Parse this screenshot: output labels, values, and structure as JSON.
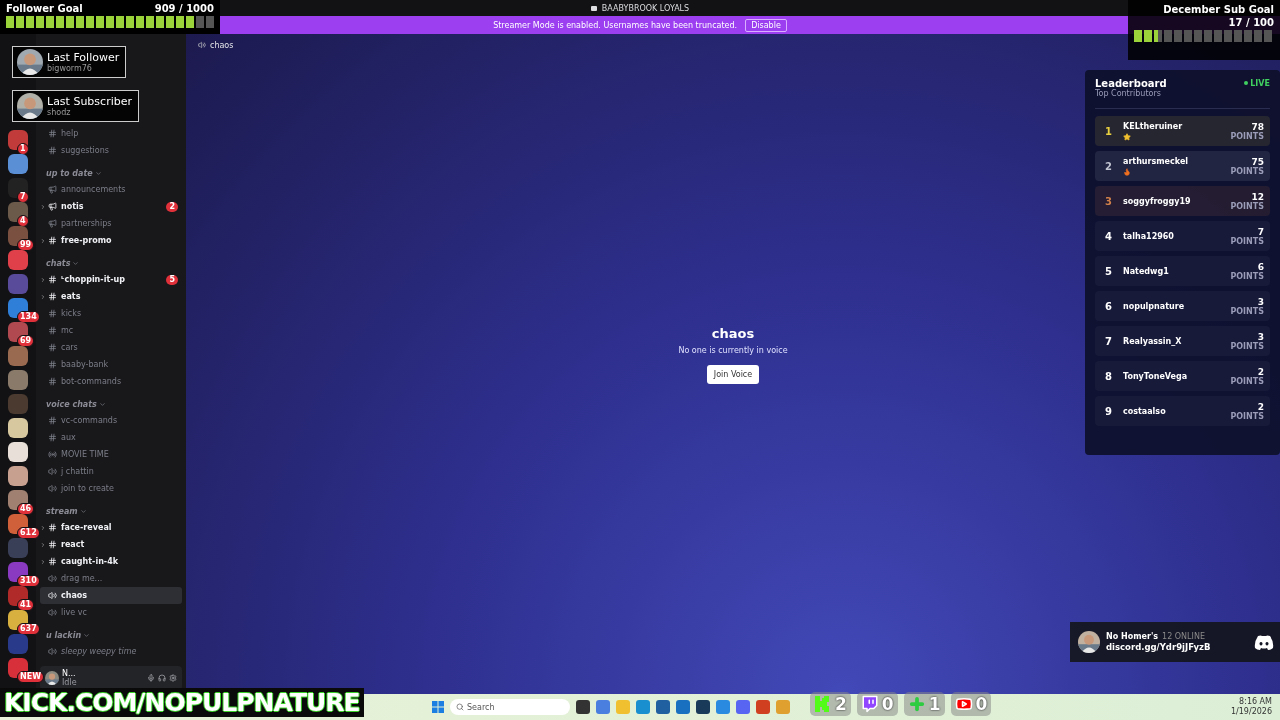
{
  "title_bar": {
    "title": "BAABYBROOK LOYALS"
  },
  "banner": {
    "text": "Streamer Mode is enabled. Usernames have been truncated.",
    "button": "Disable"
  },
  "servers": [
    {
      "color": "#c23b3b",
      "badge": "1"
    },
    {
      "color": "#5a8fd6"
    },
    {
      "color": "#222222",
      "badge": "7"
    },
    {
      "color": "#6b5a4a",
      "badge": "4"
    },
    {
      "color": "#7a5040",
      "badge": "99"
    },
    {
      "color": "#e0404a"
    },
    {
      "color": "#5a4a9a"
    },
    {
      "color": "#2f7fd8",
      "badge": "134"
    },
    {
      "color": "#b04a50",
      "badge": "69"
    },
    {
      "color": "#9a6a50"
    },
    {
      "color": "#8a7a6a"
    },
    {
      "color": "#4a3a30"
    },
    {
      "color": "#d8c8a0"
    },
    {
      "color": "#e8e0d8"
    },
    {
      "color": "#c8a090"
    },
    {
      "color": "#a08070",
      "badge": "46"
    },
    {
      "color": "#d0603a",
      "badge": "612"
    },
    {
      "color": "#3a3f58"
    },
    {
      "color": "#8a3ac0",
      "badge": "310"
    },
    {
      "color": "#b02a2a",
      "badge": "41"
    },
    {
      "color": "#d8b040",
      "badge": "637"
    },
    {
      "color": "#2a3a8a"
    },
    {
      "color": "#d8303a",
      "badge": "NEW"
    }
  ],
  "categories": [
    {
      "channels": [
        {
          "kind": "text",
          "name": "help",
          "unread": false,
          "selected": false,
          "threads": false
        },
        {
          "kind": "text",
          "name": "suggestions",
          "unread": false,
          "selected": false,
          "threads": false
        }
      ]
    },
    {
      "name": "up to date",
      "channels": [
        {
          "kind": "announcement",
          "name": "announcements",
          "unread": false,
          "selected": false,
          "threads": false
        },
        {
          "kind": "announcement",
          "name": "notis",
          "unread": true,
          "selected": false,
          "threads": true,
          "badge": "2"
        },
        {
          "kind": "announcement",
          "name": "partnerships",
          "unread": false,
          "selected": false,
          "threads": false
        },
        {
          "kind": "text",
          "name": "free-promo",
          "unread": true,
          "selected": false,
          "threads": true
        }
      ]
    },
    {
      "name": "chats",
      "channels": [
        {
          "kind": "text",
          "name": "ᒻchoppin-it-up",
          "unread": true,
          "selected": false,
          "threads": true,
          "badge": "5"
        },
        {
          "kind": "text",
          "name": "eats",
          "unread": true,
          "selected": false,
          "threads": true
        },
        {
          "kind": "text",
          "name": "kicks",
          "unread": false,
          "selected": false,
          "threads": false
        },
        {
          "kind": "text",
          "name": "mc",
          "unread": false,
          "selected": false,
          "threads": false
        },
        {
          "kind": "text",
          "name": "cars",
          "unread": false,
          "selected": false,
          "threads": false
        },
        {
          "kind": "text",
          "name": "baaby-bank",
          "unread": false,
          "selected": false,
          "threads": false
        },
        {
          "kind": "text",
          "name": "bot-commands",
          "unread": false,
          "selected": false,
          "threads": false
        }
      ]
    },
    {
      "name": "voice chats",
      "channels": [
        {
          "kind": "text",
          "name": "vc-commands",
          "unread": false,
          "selected": false,
          "threads": false
        },
        {
          "kind": "text",
          "name": "aux",
          "unread": false,
          "selected": false,
          "threads": false
        },
        {
          "kind": "stage",
          "name": "MOVIE TIME",
          "unread": false,
          "selected": false,
          "threads": false
        },
        {
          "kind": "voice",
          "name": "j chattin",
          "unread": false,
          "selected": false,
          "threads": false
        },
        {
          "kind": "voice",
          "name": "join to create",
          "unread": false,
          "selected": false,
          "threads": false
        }
      ]
    },
    {
      "name": "stream",
      "channels": [
        {
          "kind": "text",
          "name": "face-reveal",
          "unread": true,
          "selected": false,
          "threads": true
        },
        {
          "kind": "text",
          "name": "react",
          "unread": true,
          "selected": false,
          "threads": true
        },
        {
          "kind": "text",
          "name": "caught-in-4k",
          "unread": true,
          "selected": false,
          "threads": true
        },
        {
          "kind": "voice",
          "name": "drag me...",
          "unread": false,
          "selected": false,
          "threads": false
        },
        {
          "kind": "voice",
          "name": "chaos",
          "unread": true,
          "selected": true,
          "threads": false
        },
        {
          "kind": "voice",
          "name": "live vc",
          "unread": false,
          "selected": false,
          "threads": false
        }
      ]
    },
    {
      "name": "u lackin",
      "channels": [
        {
          "kind": "voice",
          "name": "sleepy weepy time",
          "unread": false,
          "selected": false,
          "threads": false,
          "italic": true
        }
      ]
    }
  ],
  "user_panel": {
    "name": "N...",
    "status": "Idle"
  },
  "channel_header": {
    "name": "chaos"
  },
  "voice_empty": {
    "title": "chaos",
    "subtitle": "No one is currently in voice",
    "button": "Join Voice"
  },
  "follower_goal": {
    "title": "Follower Goal",
    "count": "909 / 1000",
    "level": 0.909
  },
  "last_follower": {
    "title": "Last Follower",
    "name": "bigworm76"
  },
  "last_subscriber": {
    "title": "Last Subscriber",
    "name": "shodz"
  },
  "sub_goal": {
    "title": "December Sub Goal",
    "count": "17 / 100",
    "level": 0.17
  },
  "leaderboard": {
    "title": "Leaderboard",
    "subtitle": "Top Contributors",
    "live": "LIVE",
    "rows": [
      {
        "rank": "1",
        "name": "KELtheruiner",
        "kind": "star",
        "points": "78",
        "unit": "POINTS",
        "color": "#e8d040"
      },
      {
        "rank": "2",
        "name": "arthursmeckel",
        "kind": "fire",
        "points": "75",
        "unit": "POINTS",
        "color": "#c0c4d0"
      },
      {
        "rank": "3",
        "name": "soggyfroggy19",
        "points": "12",
        "unit": "POINTS",
        "color": "#d0804a"
      },
      {
        "rank": "4",
        "name": "talha12960",
        "points": "7",
        "unit": "POINTS",
        "color": "#ffffff"
      },
      {
        "rank": "5",
        "name": "Natedwg1",
        "points": "6",
        "unit": "POINTS",
        "color": "#ffffff"
      },
      {
        "rank": "6",
        "name": "nopulpnature",
        "points": "3",
        "unit": "POINTS",
        "color": "#ffffff"
      },
      {
        "rank": "7",
        "name": "Realyassin_X",
        "points": "3",
        "unit": "POINTS",
        "color": "#ffffff"
      },
      {
        "rank": "8",
        "name": "TonyToneVega",
        "points": "2",
        "unit": "POINTS",
        "color": "#ffffff"
      },
      {
        "rank": "9",
        "name": "costaalso",
        "points": "2",
        "unit": "POINTS",
        "color": "#ffffff"
      }
    ]
  },
  "discord_card": {
    "server": "No Homer's",
    "online": "12 ONLINE",
    "invite": "discord.gg/Ydr9jJFyzB"
  },
  "kick_banner": {
    "text": "KICK.COM/NOPULPNATURE"
  },
  "platform_counters": [
    {
      "kind": "kick",
      "count": "2"
    },
    {
      "kind": "twitch",
      "count": "0"
    },
    {
      "kind": "plus",
      "count": "1"
    },
    {
      "kind": "youtube",
      "count": "0"
    }
  ],
  "taskbar": {
    "search": "Search",
    "time": "8:16 AM",
    "date": "1/19/2026"
  }
}
